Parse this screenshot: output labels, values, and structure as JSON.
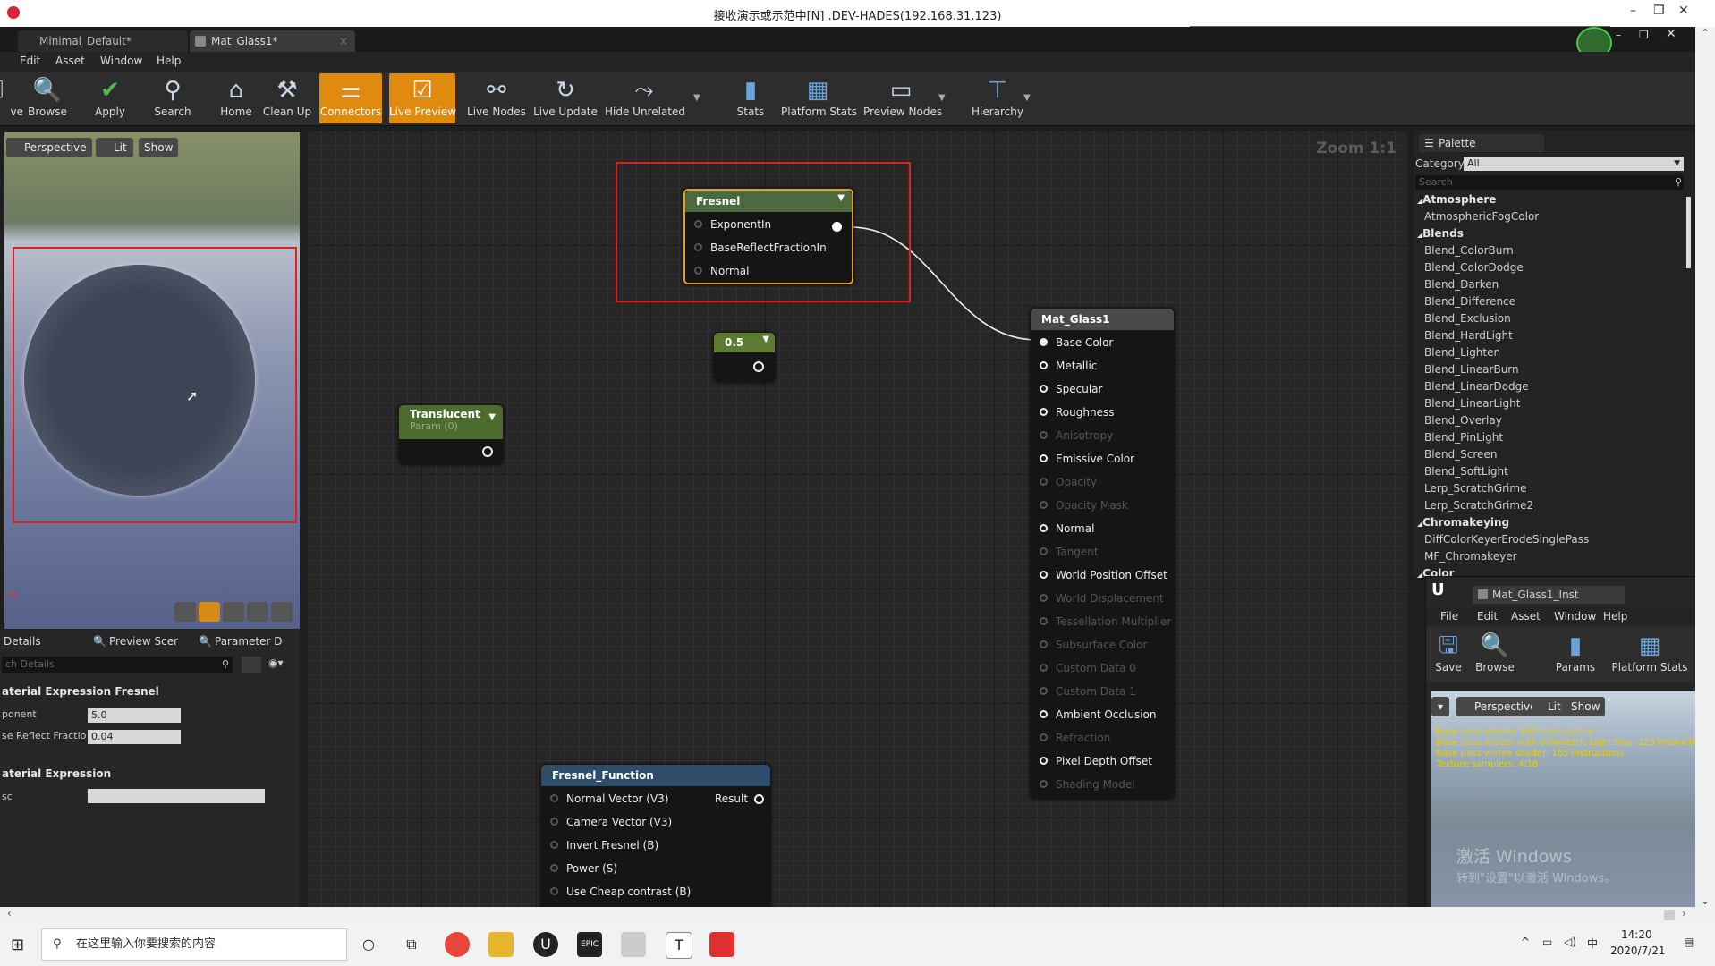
{
  "remote_title": "接收演示或示范中[N] .DEV-HADES(192.168.31.123)",
  "window_controls": {
    "minimize": "–",
    "restore": "❐",
    "close": "✕"
  },
  "doc_tabs": [
    {
      "label": "Minimal_Default*"
    },
    {
      "label": "Mat_Glass1*"
    }
  ],
  "menu": [
    "Edit",
    "Asset",
    "Window",
    "Help"
  ],
  "toolbar": [
    {
      "label": "ve",
      "icon": "save-icon",
      "glyph": "🖫"
    },
    {
      "label": "Browse",
      "icon": "magnifier-icon",
      "glyph": "🔍"
    },
    {
      "label": "Apply",
      "icon": "check-icon",
      "glyph": "✔"
    },
    {
      "label": "Search",
      "icon": "binoculars-icon",
      "glyph": "⚲"
    },
    {
      "label": "Home",
      "icon": "home-icon",
      "glyph": "⌂"
    },
    {
      "label": "Clean Up",
      "icon": "broom-icon",
      "glyph": "⚒"
    },
    {
      "label": "Connectors",
      "icon": "connectors-icon",
      "glyph": "⚌"
    },
    {
      "label": "Live Preview",
      "icon": "monitor-check-icon",
      "glyph": "☑"
    },
    {
      "label": "Live Nodes",
      "icon": "live-nodes-icon",
      "glyph": "⚯"
    },
    {
      "label": "Live Update",
      "icon": "live-update-icon",
      "glyph": "↻"
    },
    {
      "label": "Hide Unrelated",
      "icon": "hide-unrelated-icon",
      "glyph": "⤳"
    },
    {
      "label": "Stats",
      "icon": "bar-chart-icon",
      "glyph": "▮"
    },
    {
      "label": "Platform Stats",
      "icon": "platform-stats-icon",
      "glyph": "▦"
    },
    {
      "label": "Preview Nodes",
      "icon": "preview-nodes-icon",
      "glyph": "▭"
    },
    {
      "label": "Hierarchy",
      "icon": "hierarchy-icon",
      "glyph": "⊤"
    }
  ],
  "viewport": {
    "perspective": "Perspective",
    "lit": "Lit",
    "show": "Show"
  },
  "details": {
    "tabs": [
      "Details",
      "Preview Scer",
      "Parameter D"
    ],
    "search_placeholder": "ch Details",
    "section1": "aterial Expression Fresnel",
    "rows": [
      {
        "label": "ponent",
        "value": "5.0"
      },
      {
        "label": "se Reflect Fractio",
        "value": "0.04"
      }
    ],
    "section2": "aterial Expression",
    "row3_label": "sc"
  },
  "graph": {
    "zoom": "Zoom 1:1",
    "fresnel": {
      "title": "Fresnel",
      "pins": [
        "ExponentIn",
        "BaseReflectFractionIn",
        "Normal"
      ]
    },
    "const": {
      "title": "0.5"
    },
    "translucent": {
      "title": "Translucent",
      "subtitle": "Param (0)"
    },
    "material": {
      "title": "Mat_Glass1",
      "pins": [
        {
          "label": "Base Color",
          "active": true
        },
        {
          "label": "Metallic",
          "active": true
        },
        {
          "label": "Specular",
          "active": true
        },
        {
          "label": "Roughness",
          "active": true
        },
        {
          "label": "Anisotropy",
          "active": false
        },
        {
          "label": "Emissive Color",
          "active": true
        },
        {
          "label": "Opacity",
          "active": false
        },
        {
          "label": "Opacity Mask",
          "active": false
        },
        {
          "label": "Normal",
          "active": true
        },
        {
          "label": "Tangent",
          "active": false
        },
        {
          "label": "World Position Offset",
          "active": true
        },
        {
          "label": "World Displacement",
          "active": false
        },
        {
          "label": "Tessellation Multiplier",
          "active": false
        },
        {
          "label": "Subsurface Color",
          "active": false
        },
        {
          "label": "Custom Data 0",
          "active": false
        },
        {
          "label": "Custom Data 1",
          "active": false
        },
        {
          "label": "Ambient Occlusion",
          "active": true
        },
        {
          "label": "Refraction",
          "active": false
        },
        {
          "label": "Pixel Depth Offset",
          "active": true
        },
        {
          "label": "Shading Model",
          "active": false
        }
      ]
    },
    "fresnel_function": {
      "title": "Fresnel_Function",
      "pins": [
        "Normal Vector (V3)",
        "Camera Vector (V3)",
        "Invert Fresnel (B)",
        "Power (S)",
        "Use Cheap contrast (B)"
      ],
      "output": "Result"
    }
  },
  "palette": {
    "title": "Palette",
    "category_label": "Category:",
    "category_value": "All",
    "search_placeholder": "Search",
    "groups": [
      {
        "name": "Atmosphere",
        "items": [
          "AtmosphericFogColor"
        ]
      },
      {
        "name": "Blends",
        "items": [
          "Blend_ColorBurn",
          "Blend_ColorDodge",
          "Blend_Darken",
          "Blend_Difference",
          "Blend_Exclusion",
          "Blend_HardLight",
          "Blend_Lighten",
          "Blend_LinearBurn",
          "Blend_LinearDodge",
          "Blend_LinearLight",
          "Blend_Overlay",
          "Blend_PinLight",
          "Blend_Screen",
          "Blend_SoftLight",
          "Lerp_ScratchGrime",
          "Lerp_ScratchGrime2"
        ]
      },
      {
        "name": "Chromakeying",
        "items": [
          "DiffColorKeyerErodeSinglePass",
          "MF_Chromakeyer"
        ]
      },
      {
        "name": "Color",
        "items": []
      }
    ]
  },
  "inst": {
    "tab": "Mat_Glass1_Inst",
    "menu": [
      "File",
      "Edit",
      "Asset",
      "Window",
      "Help"
    ],
    "toolbar": [
      {
        "label": "Save",
        "icon": "save-icon",
        "glyph": "🖫"
      },
      {
        "label": "Browse",
        "icon": "magnifier-icon",
        "glyph": "🔍"
      },
      {
        "label": "Params",
        "icon": "params-icon",
        "glyph": "▮"
      },
      {
        "label": "Platform Stats",
        "icon": "platform-stats-icon",
        "glyph": "▦"
      }
    ],
    "viewport": {
      "perspective": "Perspective",
      "lit": "Lit",
      "show": "Show"
    },
    "stats": [
      "Base pass shader: 102 instructions",
      "Base pass shader with Volumetric Lightmap: 123 instructio",
      "Base pass vertex shader: 165 instructions",
      "Texture samplers: 4/16"
    ],
    "watermark1": "激活 Windows",
    "watermark2": "转到\"设置\"以激活 Windows。"
  },
  "taskbar": {
    "search_placeholder": "在这里输入你要搜索的内容",
    "time": "14:20",
    "date": "2020/7/21",
    "ime": "中"
  }
}
